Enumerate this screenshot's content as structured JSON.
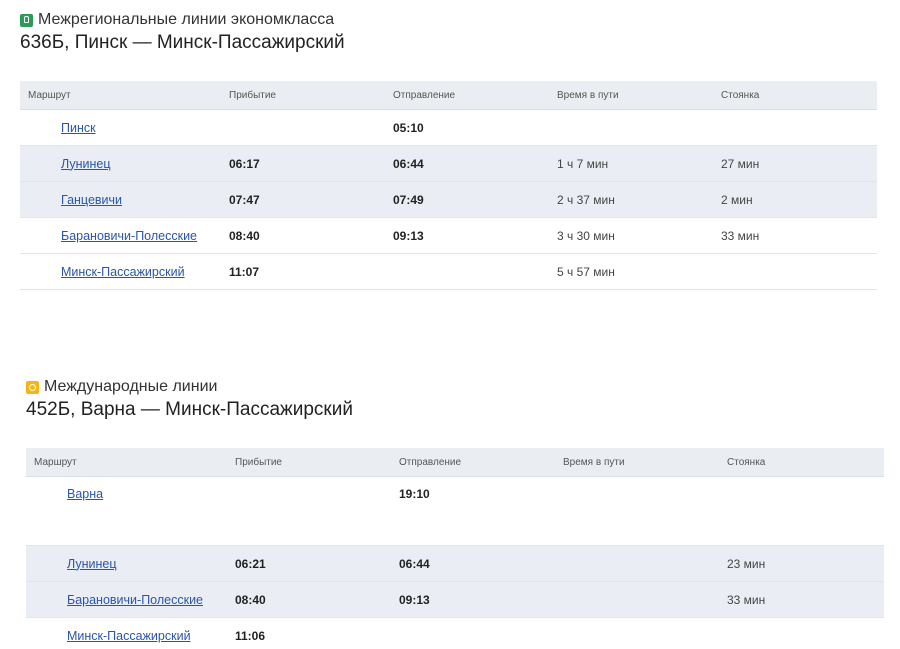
{
  "trains": [
    {
      "category": "Межрегиональные линии экономкласса",
      "category_icon": "regional-train-icon",
      "category_color": "#2e9a57",
      "title": "636Б, Пинск — Минск-Пассажирский",
      "headers": {
        "route": "Маршрут",
        "arrival": "Прибытие",
        "departure": "Отправление",
        "travel_time": "Время в пути",
        "stop": "Стоянка"
      },
      "rows": [
        {
          "station": "Пинск",
          "arrival": "",
          "departure": "05:10",
          "travel_time": "",
          "stop": ""
        },
        {
          "station": "Лунинец",
          "arrival": "06:17",
          "departure": "06:44",
          "travel_time": "1 ч 7 мин",
          "stop": "27 мин"
        },
        {
          "station": "Ганцевичи",
          "arrival": "07:47",
          "departure": "07:49",
          "travel_time": "2 ч 37 мин",
          "stop": "2 мин"
        },
        {
          "station": "Барановичи-Полесские",
          "arrival": "08:40",
          "departure": "09:13",
          "travel_time": "3 ч 30 мин",
          "stop": "33 мин"
        },
        {
          "station": "Минск-Пассажирский",
          "arrival": "11:07",
          "departure": "",
          "travel_time": "5 ч 57 мин",
          "stop": ""
        }
      ]
    },
    {
      "category": "Международные линии",
      "category_icon": "international-train-icon",
      "category_color": "#f3b51a",
      "title": "452Б, Варна — Минск-Пассажирский",
      "headers": {
        "route": "Маршрут",
        "arrival": "Прибытие",
        "departure": "Отправление",
        "travel_time": "Время в пути",
        "stop": "Стоянка"
      },
      "rows": [
        {
          "station": "Варна",
          "arrival": "",
          "departure": "19:10",
          "travel_time": "",
          "stop": ""
        },
        {
          "station": "Лунинец",
          "arrival": "06:21",
          "departure": "06:44",
          "travel_time": "",
          "stop": "23 мин"
        },
        {
          "station": "Барановичи-Полесские",
          "arrival": "08:40",
          "departure": "09:13",
          "travel_time": "",
          "stop": "33 мин"
        },
        {
          "station": "Минск-Пассажирский",
          "arrival": "11:06",
          "departure": "",
          "travel_time": "",
          "stop": ""
        }
      ]
    }
  ]
}
